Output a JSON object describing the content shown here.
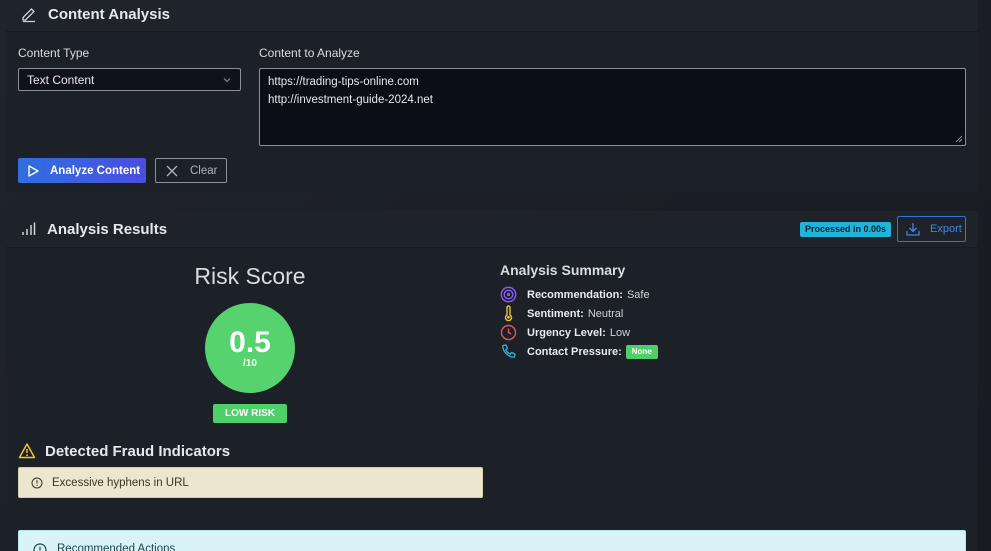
{
  "content_analysis": {
    "title": "Content Analysis",
    "content_type_label": "Content Type",
    "content_type_value": "Text Content",
    "content_label": "Content to Analyze",
    "content_lines": [
      "https://trading-tips-online.com",
      "http://investment-guide-2024.net"
    ],
    "analyze_button": "Analyze Content",
    "clear_button": "Clear"
  },
  "results": {
    "title": "Analysis Results",
    "processed_badge": "Processed in 0.00s",
    "export_button": "Export",
    "risk": {
      "title": "Risk Score",
      "value": "0.5",
      "max": "/10",
      "level": "LOW RISK"
    },
    "summary": {
      "title": "Analysis Summary",
      "recommendation_label": "Recommendation:",
      "recommendation_value": "Safe",
      "sentiment_label": "Sentiment:",
      "sentiment_value": "Neutral",
      "urgency_label": "Urgency Level:",
      "urgency_value": "Low",
      "pressure_label": "Contact Pressure:",
      "pressure_value": "None"
    },
    "fraud": {
      "title": "Detected Fraud Indicators",
      "items": [
        "Excessive hyphens in URL"
      ]
    },
    "recommended_title": "Recommended Actions"
  },
  "colors": {
    "accent_blue": "#2f6fe0",
    "risk_green": "#56d36e",
    "processed_cyan": "#23b3d8",
    "warning_yellow": "#f2c230"
  }
}
